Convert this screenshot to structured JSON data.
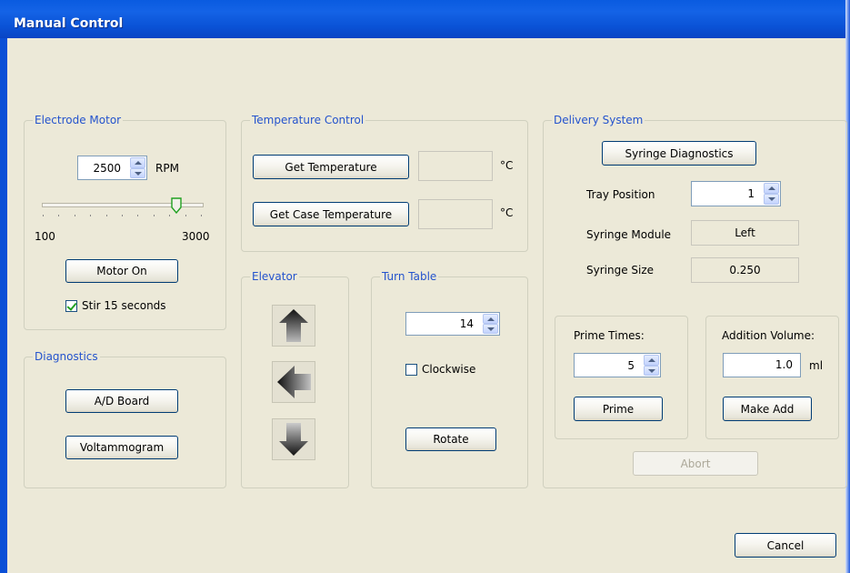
{
  "window": {
    "title": "Manual Control"
  },
  "electrode_motor": {
    "title": "Electrode Motor",
    "rpm_value": "2500",
    "rpm_unit": "RPM",
    "slider_min": "100",
    "slider_max": "3000",
    "slider_level": 0.84,
    "motor_button": "Motor On",
    "stir_label": "Stir 15 seconds",
    "stir_checked": true
  },
  "diagnostics": {
    "title": "Diagnostics",
    "ad_board_button": "A/D Board",
    "voltammogram_button": "Voltammogram"
  },
  "temperature_control": {
    "title": "Temperature Control",
    "get_temperature_button": "Get Temperature",
    "get_case_temperature_button": "Get Case Temperature",
    "temperature_value": "",
    "case_temperature_value": "",
    "unit": "°C"
  },
  "elevator": {
    "title": "Elevator",
    "icons": [
      "arrow-up-icon",
      "arrow-left-icon",
      "arrow-down-icon"
    ]
  },
  "turn_table": {
    "title": "Turn Table",
    "position_value": "14",
    "clockwise_label": "Clockwise",
    "clockwise_checked": false,
    "rotate_button": "Rotate"
  },
  "delivery_system": {
    "title": "Delivery System",
    "syringe_diagnostics_button": "Syringe Diagnostics",
    "tray_position_label": "Tray Position",
    "tray_position_value": "1",
    "syringe_module_label": "Syringe Module",
    "syringe_module_value": "Left",
    "syringe_size_label": "Syringe Size",
    "syringe_size_value": "0.250",
    "prime_times_label": "Prime Times:",
    "prime_times_value": "5",
    "prime_button": "Prime",
    "addition_volume_label": "Addition Volume:",
    "addition_volume_value": "1.0",
    "addition_volume_unit": "ml",
    "make_add_button": "Make Add",
    "abort_button": "Abort"
  },
  "footer": {
    "cancel_button": "Cancel"
  }
}
